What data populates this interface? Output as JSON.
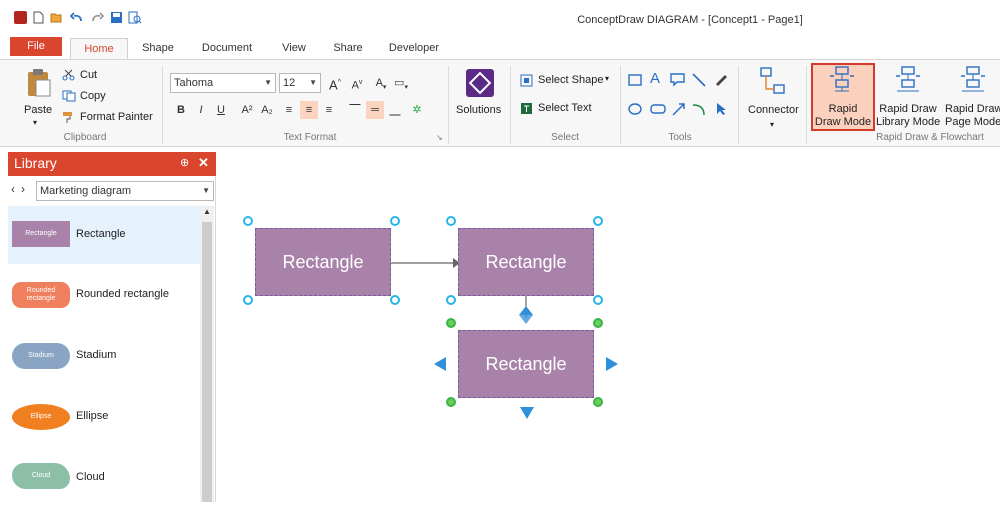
{
  "app": {
    "title": "ConceptDraw DIAGRAM - [Concept1 - Page1]",
    "accent": "#d9452d"
  },
  "quick_access": [
    "app-icon",
    "new-icon",
    "open-icon",
    "undo-icon",
    "redo-icon",
    "save-icon",
    "print-preview-icon"
  ],
  "tabs": [
    {
      "label": "File"
    },
    {
      "label": "Home"
    },
    {
      "label": "Shape"
    },
    {
      "label": "Document"
    },
    {
      "label": "View"
    },
    {
      "label": "Share"
    },
    {
      "label": "Developer"
    }
  ],
  "ribbon": {
    "clipboard": {
      "paste": "Paste",
      "cut": "Cut",
      "copy": "Copy",
      "format_painter": "Format Painter",
      "group": "Clipboard"
    },
    "text_format": {
      "font": "Tahoma",
      "size": "12",
      "group": "Text Format"
    },
    "solutions": {
      "label": "Solutions"
    },
    "select": {
      "select_shape": "Select Shape",
      "select_text": "Select Text",
      "group": "Select"
    },
    "tools": {
      "group": "Tools"
    },
    "connector": {
      "label": "Connector"
    },
    "rapid": {
      "draw_mode_1": "Rapid",
      "draw_mode_2": "Draw Mode",
      "library_mode_1": "Rapid Draw",
      "library_mode_2": "Library Mode",
      "page_mode_1": "Rapid Draw",
      "page_mode_2": "Page Mode",
      "group": "Rapid Draw & Flowchart"
    }
  },
  "library": {
    "title": "Library",
    "current": "Marketing diagram",
    "items": [
      {
        "label": "Rectangle",
        "thumb": "Rectangle",
        "color": "#a982a9"
      },
      {
        "label": "Rounded rectangle",
        "thumb": "Rounded rectangle",
        "color": "#f07f5e"
      },
      {
        "label": "Stadium",
        "thumb": "Stadium",
        "color": "#8aa4c3"
      },
      {
        "label": "Ellipse",
        "thumb": "Ellipse",
        "color": "#f07f1f"
      },
      {
        "label": "Cloud",
        "thumb": "Cloud",
        "color": "#8dbfa8"
      }
    ]
  },
  "canvas": {
    "shapes": [
      {
        "label": "Rectangle"
      },
      {
        "label": "Rectangle"
      },
      {
        "label": "Rectangle"
      }
    ],
    "shape_color": "#a982a9",
    "selection_handle_color": "#27b5e6",
    "active_handle_color": "#39b54a",
    "arrow_color": "#2f8fd8"
  }
}
